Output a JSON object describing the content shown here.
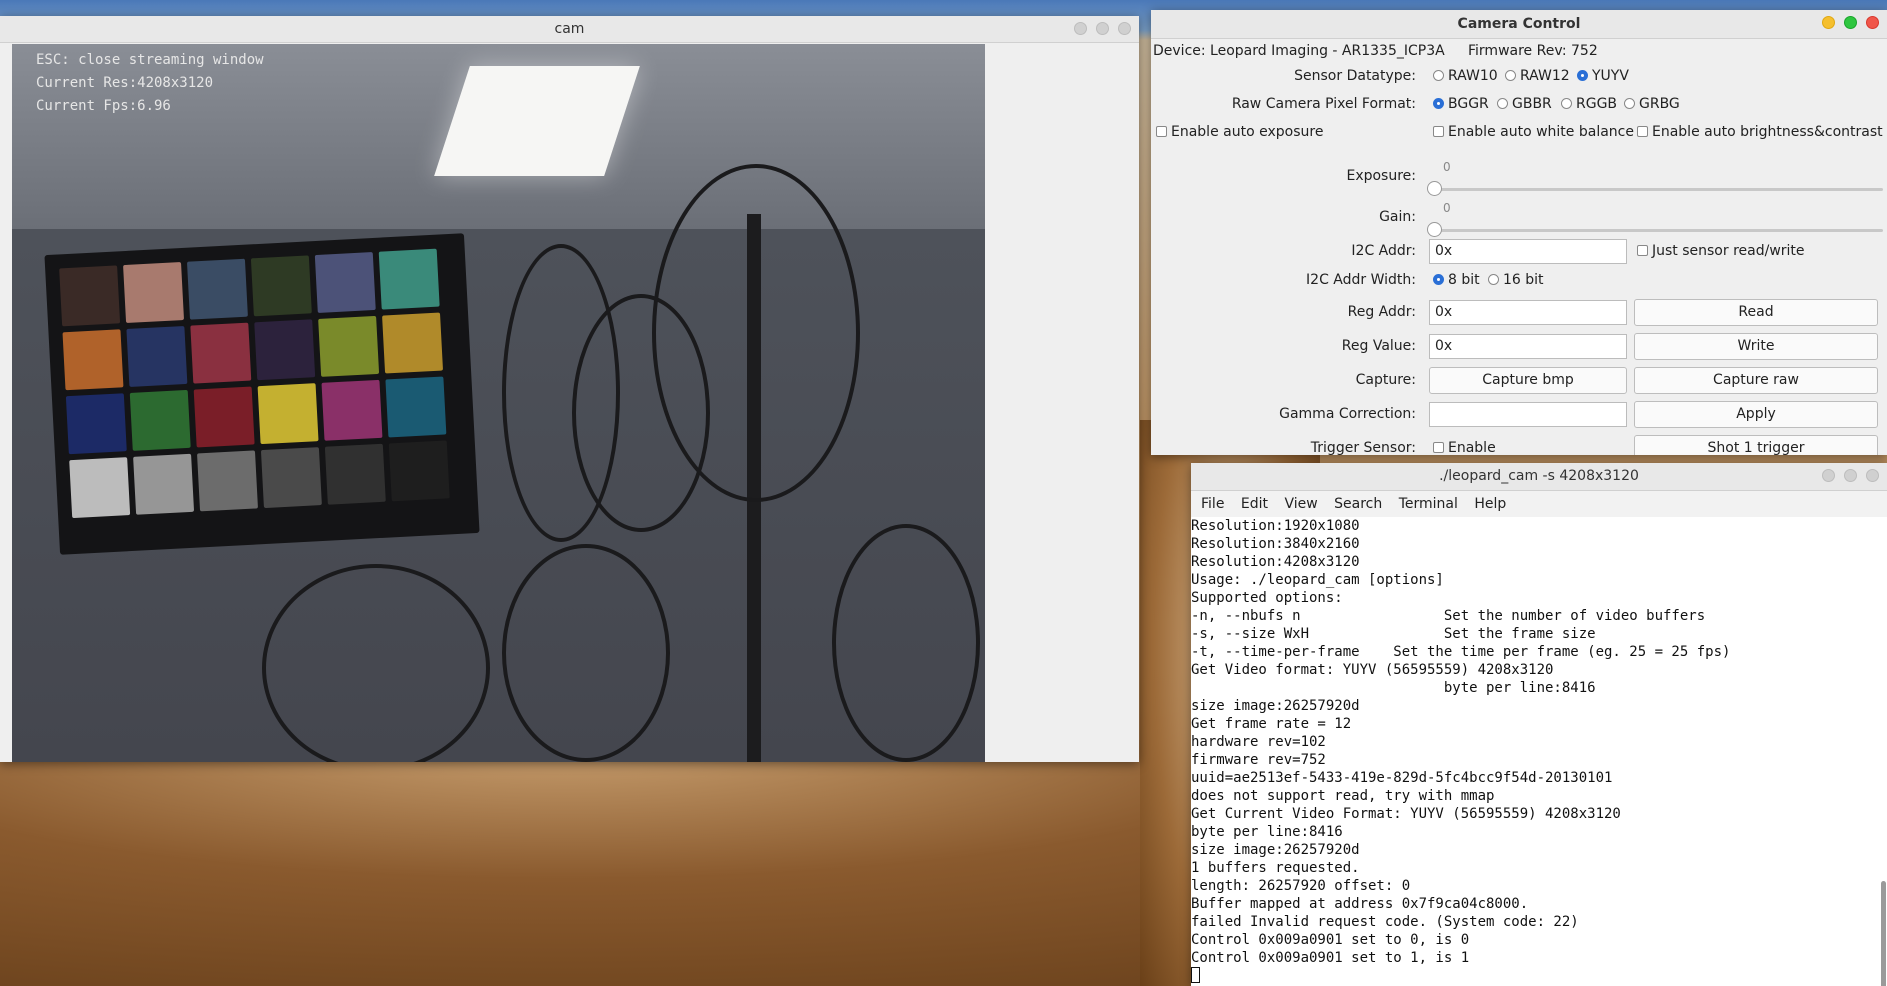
{
  "cam_window": {
    "title": "cam",
    "overlay": [
      "ESC: close streaming window",
      "Current Res:4208x3120",
      "Current Fps:6.96"
    ]
  },
  "camera_control": {
    "title": "Camera Control",
    "device": "Device: Leopard Imaging - AR1335_ICP3A",
    "firmware": "Firmware Rev: 752",
    "sensor_datatype_label": "Sensor Datatype:",
    "sensor_datatype_options": [
      "RAW10",
      "RAW12",
      "YUYV"
    ],
    "sensor_datatype_selected": "YUYV",
    "pixel_format_label": "Raw Camera Pixel Format:",
    "pixel_format_options": [
      "BGGR",
      "GBBR",
      "RGGB",
      "GRBG"
    ],
    "pixel_format_selected": "BGGR",
    "auto_exposure": "Enable auto exposure",
    "auto_white_balance": "Enable auto white balance",
    "auto_brightness": "Enable auto brightness&contrast",
    "exposure_label": "Exposure:",
    "exposure_value": "0",
    "gain_label": "Gain:",
    "gain_value": "0",
    "i2c_addr_label": "I2C Addr:",
    "i2c_addr_value": "0x",
    "just_sensor": "Just sensor read/write",
    "i2c_width_label": "I2C Addr Width:",
    "i2c_width_options": [
      "8 bit",
      "16 bit"
    ],
    "i2c_width_selected": "8 bit",
    "reg_addr_label": "Reg Addr:",
    "reg_addr_value": "0x",
    "read_button": "Read",
    "reg_value_label": "Reg Value:",
    "reg_value_value": "0x",
    "write_button": "Write",
    "capture_label": "Capture:",
    "capture_bmp": "Capture bmp",
    "capture_raw": "Capture raw",
    "gamma_label": "Gamma Correction:",
    "gamma_value": "",
    "apply_button": "Apply",
    "trigger_label": "Trigger Sensor:",
    "trigger_enable": "Enable",
    "shot_button": "Shot 1 trigger"
  },
  "terminal": {
    "title": "./leopard_cam -s 4208x3120",
    "menu": [
      "File",
      "Edit",
      "View",
      "Search",
      "Terminal",
      "Help"
    ],
    "lines": [
      "Resolution:1920x1080",
      "Resolution:3840x2160",
      "Resolution:4208x3120",
      "Usage: ./leopard_cam [options]",
      "Supported options:",
      "-n, --nbufs n                 Set the number of video buffers",
      "-s, --size WxH                Set the frame size",
      "-t, --time-per-frame    Set the time per frame (eg. 25 = 25 fps)",
      "Get Video format: YUYV (56595559) 4208x3120",
      "                              byte per line:8416",
      "size image:26257920d",
      "Get frame rate = 12",
      "hardware rev=102",
      "firmware rev=752",
      "uuid=ae2513ef-5433-419e-829d-5fc4bcc9f54d-20130101",
      "does not support read, try with mmap",
      "Get Current Video Format: YUYV (56595559) 4208x3120",
      "byte per line:8416",
      "size image:26257920d",
      "1 buffers requested.",
      "length: 26257920 offset: 0",
      "Buffer mapped at address 0x7f9ca04c8000.",
      "failed Invalid request code. (System code: 22)",
      "Control 0x009a0901 set to 0, is 0",
      "Control 0x009a0901 set to 1, is 1"
    ]
  },
  "colors": {
    "radio_selected": "#2a6fd6",
    "close_red": "#f0564a",
    "min_yellow": "#f5bf2e",
    "max_green": "#2fc640"
  }
}
